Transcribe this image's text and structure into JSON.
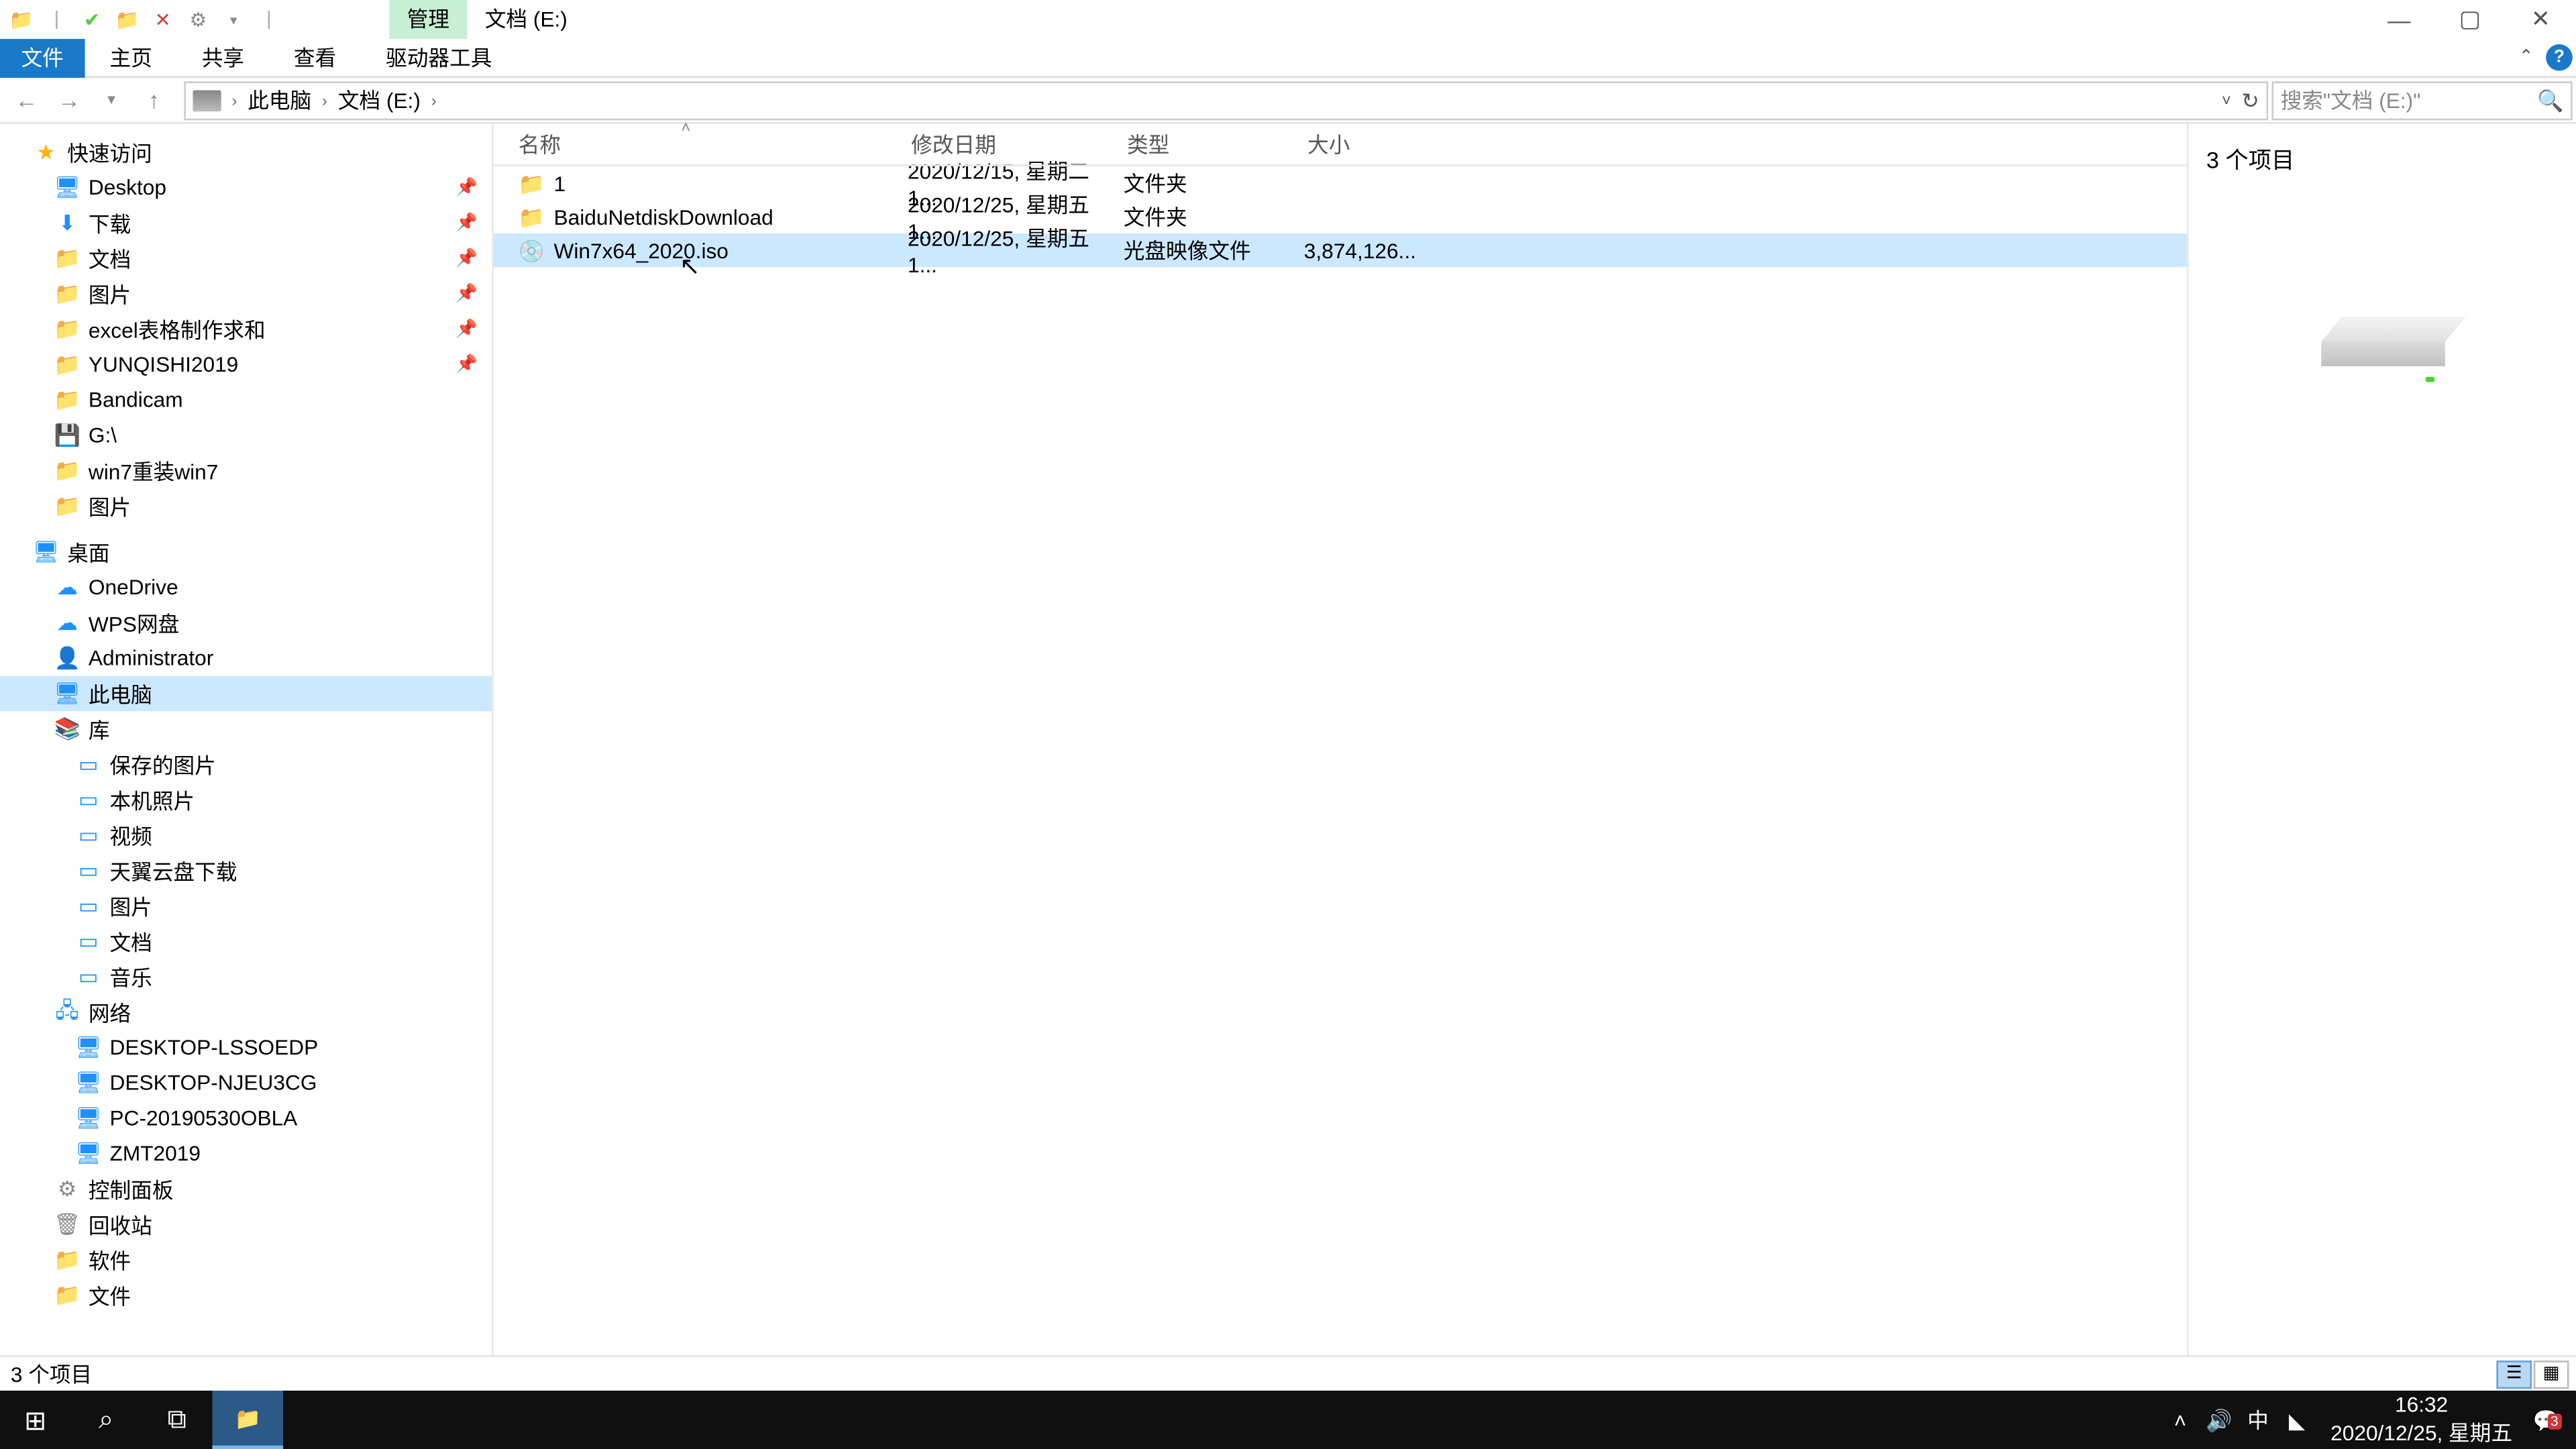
{
  "title_tabs": {
    "manage": "管理",
    "drive_label": "文档 (E:)"
  },
  "ribbon": {
    "file": "文件",
    "home": "主页",
    "share": "共享",
    "view": "查看",
    "drive_tools": "驱动器工具"
  },
  "address": {
    "this_pc": "此电脑",
    "drive": "文档 (E:)"
  },
  "search": {
    "placeholder": "搜索\"文档 (E:)\""
  },
  "columns": {
    "name": "名称",
    "date": "修改日期",
    "type": "类型",
    "size": "大小"
  },
  "files": [
    {
      "icon": "📁",
      "name": "1",
      "date": "2020/12/15, 星期二 1...",
      "type": "文件夹",
      "size": ""
    },
    {
      "icon": "📁",
      "name": "BaiduNetdiskDownload",
      "date": "2020/12/25, 星期五 1...",
      "type": "文件夹",
      "size": ""
    },
    {
      "icon": "💿",
      "name": "Win7x64_2020.iso",
      "date": "2020/12/25, 星期五 1...",
      "type": "光盘映像文件",
      "size": "3,874,126..."
    }
  ],
  "nav": {
    "quick_access": "快速访问",
    "quick_items": [
      "Desktop",
      "下载",
      "文档",
      "图片",
      "excel表格制作求和",
      "YUNQISHI2019",
      "Bandicam",
      "G:\\",
      "win7重装win7",
      "图片"
    ],
    "desktop": "桌面",
    "desktop_items": [
      {
        "l": "OneDrive",
        "i": "☁",
        "c": "blue"
      },
      {
        "l": "WPS网盘",
        "i": "☁",
        "c": "blue"
      },
      {
        "l": "Administrator",
        "i": "👤",
        "c": ""
      },
      {
        "l": "此电脑",
        "i": "🖥",
        "c": "blue",
        "sel": true
      },
      {
        "l": "库",
        "i": "📚",
        "c": ""
      },
      {
        "l": "网络",
        "i": "🖧",
        "c": "blue"
      },
      {
        "l": "控制面板",
        "i": "⚙",
        "c": "gray"
      },
      {
        "l": "回收站",
        "i": "🗑",
        "c": "gray"
      },
      {
        "l": "软件",
        "i": "📁",
        "c": "fold"
      },
      {
        "l": "文件",
        "i": "📁",
        "c": "fold"
      }
    ],
    "lib_items": [
      "保存的图片",
      "本机照片",
      "视频",
      "天翼云盘下载",
      "图片",
      "文档",
      "音乐"
    ],
    "net_items": [
      "DESKTOP-LSSOEDP",
      "DESKTOP-NJEU3CG",
      "PC-20190530OBLA",
      "ZMT2019"
    ]
  },
  "details": {
    "title": "3 个项目"
  },
  "status": {
    "text": "3 个项目"
  },
  "tray": {
    "ime": "中",
    "time": "16:32",
    "date": "2020/12/25, 星期五",
    "badge": "3"
  }
}
